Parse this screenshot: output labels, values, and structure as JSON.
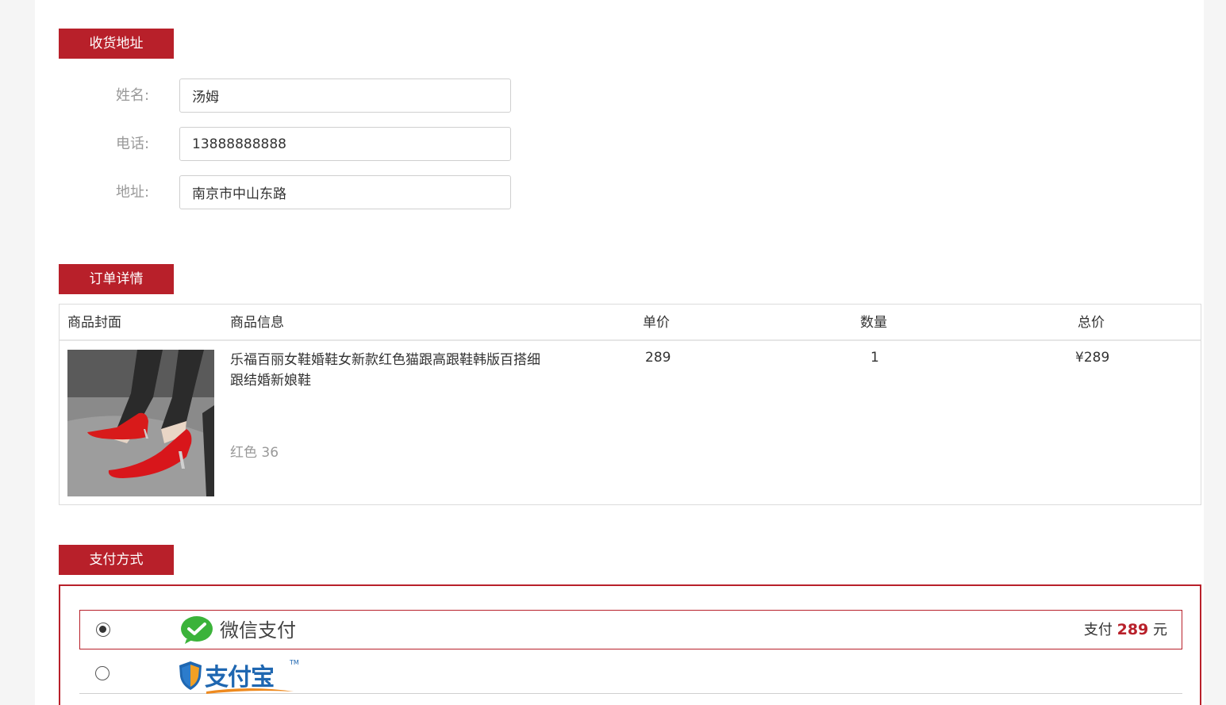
{
  "address": {
    "title": "收货地址",
    "fields": {
      "name": {
        "label": "姓名:",
        "value": "汤姆"
      },
      "phone": {
        "label": "电话:",
        "value": "13888888888"
      },
      "address": {
        "label": "地址:",
        "value": "南京市中山东路"
      }
    }
  },
  "order": {
    "title": "订单详情",
    "headers": {
      "cover": "商品封面",
      "info": "商品信息",
      "unit_price": "单价",
      "quantity": "数量",
      "total": "总价"
    },
    "item": {
      "title": "乐福百丽女鞋婚鞋女新款红色猫跟高跟鞋韩版百搭细跟结婚新娘鞋",
      "spec": "红色 36",
      "unit_price": "289",
      "quantity": "1",
      "total": "¥289"
    }
  },
  "payment": {
    "title": "支付方式",
    "methods": [
      {
        "id": "wechat",
        "label": "微信支付",
        "icon": "wechat-pay-icon",
        "selected": true,
        "amount_prefix": "支付",
        "amount": "289",
        "amount_suffix": "元"
      },
      {
        "id": "alipay",
        "label": "支付宝",
        "icon": "alipay-logo",
        "selected": false
      }
    ]
  },
  "colors": {
    "accent": "#b8202a",
    "wechat_green": "#3bb33a",
    "alipay_blue": "#1f67b1",
    "alipay_orange": "#ee8a1f"
  }
}
